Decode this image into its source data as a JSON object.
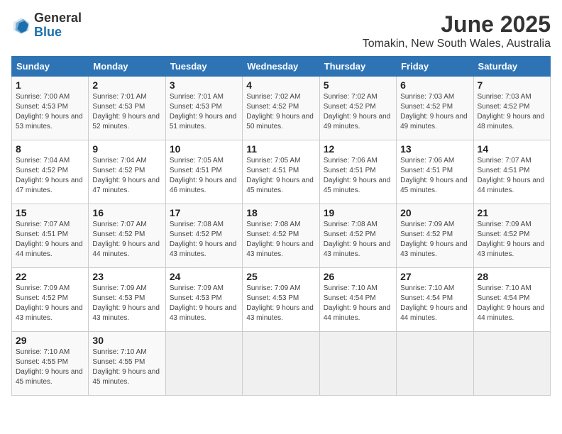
{
  "header": {
    "logo_general": "General",
    "logo_blue": "Blue",
    "month_title": "June 2025",
    "location": "Tomakin, New South Wales, Australia"
  },
  "weekdays": [
    "Sunday",
    "Monday",
    "Tuesday",
    "Wednesday",
    "Thursday",
    "Friday",
    "Saturday"
  ],
  "weeks": [
    [
      {
        "day": "1",
        "sunrise": "7:00 AM",
        "sunset": "4:53 PM",
        "daylight": "9 hours and 53 minutes."
      },
      {
        "day": "2",
        "sunrise": "7:01 AM",
        "sunset": "4:53 PM",
        "daylight": "9 hours and 52 minutes."
      },
      {
        "day": "3",
        "sunrise": "7:01 AM",
        "sunset": "4:53 PM",
        "daylight": "9 hours and 51 minutes."
      },
      {
        "day": "4",
        "sunrise": "7:02 AM",
        "sunset": "4:52 PM",
        "daylight": "9 hours and 50 minutes."
      },
      {
        "day": "5",
        "sunrise": "7:02 AM",
        "sunset": "4:52 PM",
        "daylight": "9 hours and 49 minutes."
      },
      {
        "day": "6",
        "sunrise": "7:03 AM",
        "sunset": "4:52 PM",
        "daylight": "9 hours and 49 minutes."
      },
      {
        "day": "7",
        "sunrise": "7:03 AM",
        "sunset": "4:52 PM",
        "daylight": "9 hours and 48 minutes."
      }
    ],
    [
      {
        "day": "8",
        "sunrise": "7:04 AM",
        "sunset": "4:52 PM",
        "daylight": "9 hours and 47 minutes."
      },
      {
        "day": "9",
        "sunrise": "7:04 AM",
        "sunset": "4:52 PM",
        "daylight": "9 hours and 47 minutes."
      },
      {
        "day": "10",
        "sunrise": "7:05 AM",
        "sunset": "4:51 PM",
        "daylight": "9 hours and 46 minutes."
      },
      {
        "day": "11",
        "sunrise": "7:05 AM",
        "sunset": "4:51 PM",
        "daylight": "9 hours and 45 minutes."
      },
      {
        "day": "12",
        "sunrise": "7:06 AM",
        "sunset": "4:51 PM",
        "daylight": "9 hours and 45 minutes."
      },
      {
        "day": "13",
        "sunrise": "7:06 AM",
        "sunset": "4:51 PM",
        "daylight": "9 hours and 45 minutes."
      },
      {
        "day": "14",
        "sunrise": "7:07 AM",
        "sunset": "4:51 PM",
        "daylight": "9 hours and 44 minutes."
      }
    ],
    [
      {
        "day": "15",
        "sunrise": "7:07 AM",
        "sunset": "4:51 PM",
        "daylight": "9 hours and 44 minutes."
      },
      {
        "day": "16",
        "sunrise": "7:07 AM",
        "sunset": "4:52 PM",
        "daylight": "9 hours and 44 minutes."
      },
      {
        "day": "17",
        "sunrise": "7:08 AM",
        "sunset": "4:52 PM",
        "daylight": "9 hours and 43 minutes."
      },
      {
        "day": "18",
        "sunrise": "7:08 AM",
        "sunset": "4:52 PM",
        "daylight": "9 hours and 43 minutes."
      },
      {
        "day": "19",
        "sunrise": "7:08 AM",
        "sunset": "4:52 PM",
        "daylight": "9 hours and 43 minutes."
      },
      {
        "day": "20",
        "sunrise": "7:09 AM",
        "sunset": "4:52 PM",
        "daylight": "9 hours and 43 minutes."
      },
      {
        "day": "21",
        "sunrise": "7:09 AM",
        "sunset": "4:52 PM",
        "daylight": "9 hours and 43 minutes."
      }
    ],
    [
      {
        "day": "22",
        "sunrise": "7:09 AM",
        "sunset": "4:52 PM",
        "daylight": "9 hours and 43 minutes."
      },
      {
        "day": "23",
        "sunrise": "7:09 AM",
        "sunset": "4:53 PM",
        "daylight": "9 hours and 43 minutes."
      },
      {
        "day": "24",
        "sunrise": "7:09 AM",
        "sunset": "4:53 PM",
        "daylight": "9 hours and 43 minutes."
      },
      {
        "day": "25",
        "sunrise": "7:09 AM",
        "sunset": "4:53 PM",
        "daylight": "9 hours and 43 minutes."
      },
      {
        "day": "26",
        "sunrise": "7:10 AM",
        "sunset": "4:54 PM",
        "daylight": "9 hours and 44 minutes."
      },
      {
        "day": "27",
        "sunrise": "7:10 AM",
        "sunset": "4:54 PM",
        "daylight": "9 hours and 44 minutes."
      },
      {
        "day": "28",
        "sunrise": "7:10 AM",
        "sunset": "4:54 PM",
        "daylight": "9 hours and 44 minutes."
      }
    ],
    [
      {
        "day": "29",
        "sunrise": "7:10 AM",
        "sunset": "4:55 PM",
        "daylight": "9 hours and 45 minutes."
      },
      {
        "day": "30",
        "sunrise": "7:10 AM",
        "sunset": "4:55 PM",
        "daylight": "9 hours and 45 minutes."
      },
      null,
      null,
      null,
      null,
      null
    ]
  ]
}
